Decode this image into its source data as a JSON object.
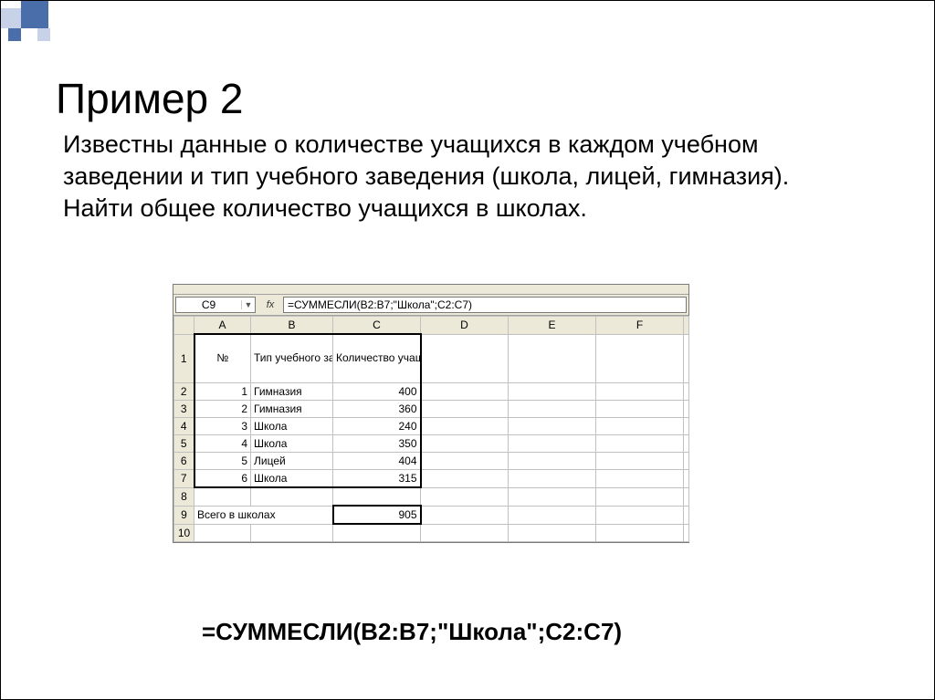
{
  "title": "Пример 2",
  "body": "Известны данные о количестве учащихся в каждом учебном заведении и тип учебного заведения (школа, лицей, гимназия). Найти общее количество учащихся в школах.",
  "formula_display": "=СУММЕСЛИ(B2:B7;\"Школа\";C2:C7)",
  "excel": {
    "namebox": "C9",
    "namebox_dropdown": "▼",
    "fx_label": "fx",
    "formula_bar": "=СУММЕСЛИ(B2:B7;\"Школа\";C2:C7)",
    "columns": [
      "A",
      "B",
      "C",
      "D",
      "E",
      "F"
    ],
    "row_headers": [
      "1",
      "2",
      "3",
      "4",
      "5",
      "6",
      "7",
      "8",
      "9",
      "10"
    ],
    "headers": {
      "A": "№",
      "B": "Тип учебного заведения",
      "C": "Количество учащихся"
    },
    "rows": [
      {
        "A": "1",
        "B": "Гимназия",
        "C": "400"
      },
      {
        "A": "2",
        "B": "Гимназия",
        "C": "360"
      },
      {
        "A": "3",
        "B": "Школа",
        "C": "240"
      },
      {
        "A": "4",
        "B": "Школа",
        "C": "350"
      },
      {
        "A": "5",
        "B": "Лицей",
        "C": "404"
      },
      {
        "A": "6",
        "B": "Школа",
        "C": "315"
      }
    ],
    "total_label": "Всего в школах",
    "total_value": "905"
  }
}
